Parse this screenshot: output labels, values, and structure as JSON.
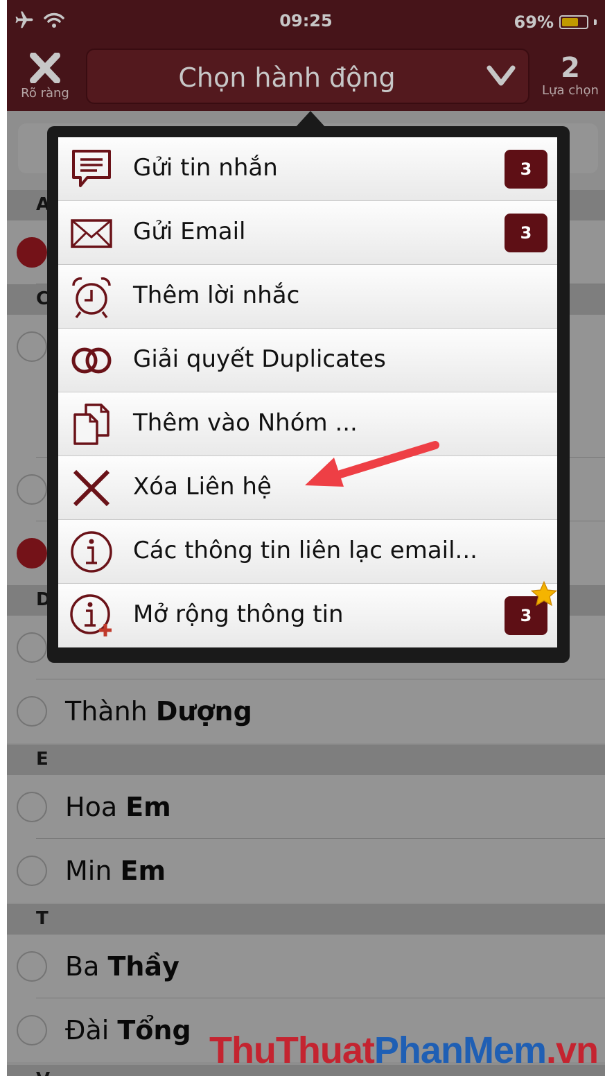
{
  "status": {
    "time": "09:25",
    "battery": "69%",
    "battery_level": 0.69
  },
  "nav": {
    "left_label": "Rõ ràng",
    "action_title": "Chọn hành động",
    "selection_count": "2",
    "right_label": "Lựa chọn"
  },
  "list": {
    "sections": [
      "A",
      "C",
      "D",
      "E",
      "T",
      "V"
    ],
    "rows": [
      {
        "first": "Thành",
        "last": "Dượng",
        "selected": false
      },
      {
        "first": "Hoa",
        "last": "Em",
        "selected": false
      },
      {
        "first": "Min",
        "last": "Em",
        "selected": false
      },
      {
        "first": "Ba",
        "last": "Thầy",
        "selected": false
      },
      {
        "first": "Đài",
        "last": "Tổng",
        "selected": false
      }
    ]
  },
  "menu": {
    "items": [
      {
        "label": "Gửi tin nhắn",
        "icon": "message-icon",
        "badge": "3"
      },
      {
        "label": "Gửi Email",
        "icon": "envelope-icon",
        "badge": "3"
      },
      {
        "label": "Thêm lời nhắc",
        "icon": "alarm-clock-icon"
      },
      {
        "label": "Giải quyết Duplicates",
        "icon": "merge-circles-icon"
      },
      {
        "label": "Thêm vào Nhóm ...",
        "icon": "documents-icon"
      },
      {
        "label": "Xóa Liên hệ",
        "icon": "delete-x-icon"
      },
      {
        "label": "Các thông tin liên lạc email...",
        "icon": "info-icon"
      },
      {
        "label": "Mở rộng thông tin",
        "icon": "info-plus-icon",
        "badge": "3",
        "star": true
      }
    ]
  },
  "colors": {
    "brand": "#5a1a21",
    "badge": "#5e0f15",
    "annotation": "#ee3f45"
  },
  "watermark": {
    "part1": "Thu",
    "part2": "Thuat",
    "part3": "Phan",
    "part4": "Mem",
    "part5": ".vn"
  }
}
